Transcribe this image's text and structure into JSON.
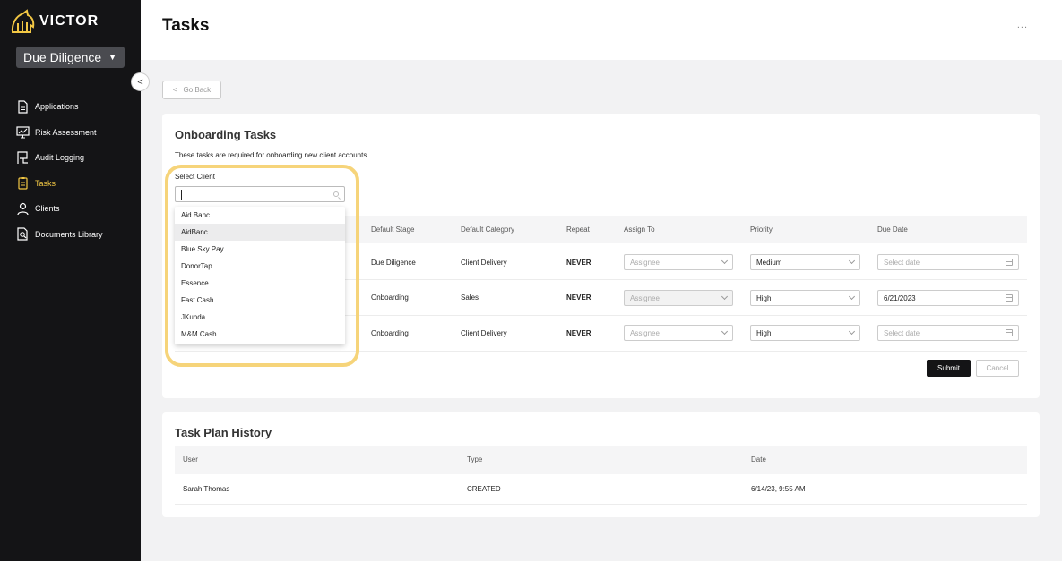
{
  "app": {
    "logo_text": "VICTOR",
    "module": "Due Diligence"
  },
  "sidebar": {
    "items": [
      {
        "label": "Applications",
        "icon": "document-icon"
      },
      {
        "label": "Risk Assessment",
        "icon": "chart-monitor-icon"
      },
      {
        "label": "Audit Logging",
        "icon": "flag-icon"
      },
      {
        "label": "Tasks",
        "icon": "clipboard-icon",
        "active": true
      },
      {
        "label": "Clients",
        "icon": "user-icon"
      },
      {
        "label": "Documents Library",
        "icon": "document-search-icon"
      }
    ]
  },
  "header": {
    "title": "Tasks",
    "more": "..."
  },
  "back": {
    "label": "Go Back"
  },
  "onboarding": {
    "title": "Onboarding Tasks",
    "description": "These tasks are required for onboarding new client accounts.",
    "select_client_label": "Select Client",
    "columns": [
      "Default Stage",
      "Default Category",
      "Repeat",
      "Assign To",
      "Priority",
      "Due Date"
    ],
    "rows": [
      {
        "stage": "Due Diligence",
        "category": "Client Delivery",
        "repeat": "NEVER",
        "assignee": "Assignee",
        "priority": "Medium",
        "due": "Select date"
      },
      {
        "stage": "Onboarding",
        "category": "Sales",
        "repeat": "NEVER",
        "assignee": "Assignee",
        "priority": "High",
        "due": "6/21/2023"
      },
      {
        "stage": "Onboarding",
        "category": "Client Delivery",
        "repeat": "NEVER",
        "assignee": "Assignee",
        "priority": "High",
        "due": "Select date"
      }
    ],
    "submit": "Submit",
    "cancel": "Cancel"
  },
  "client_dropdown": {
    "options": [
      "Aid Banc",
      "AidBanc",
      "Blue Sky Pay",
      "DonorTap",
      "Essence",
      "Fast Cash",
      "JKunda",
      "M&M Cash"
    ],
    "hovered": "AidBanc"
  },
  "history": {
    "title": "Task Plan History",
    "columns": [
      "User",
      "Type",
      "Date"
    ],
    "rows": [
      {
        "user": "Sarah Thomas",
        "type": "CREATED",
        "date": "6/14/23, 9:55 AM"
      }
    ]
  },
  "colors": {
    "sidebar_bg": "#141416",
    "accent": "#f2c744",
    "highlight": "#f6d47a"
  }
}
